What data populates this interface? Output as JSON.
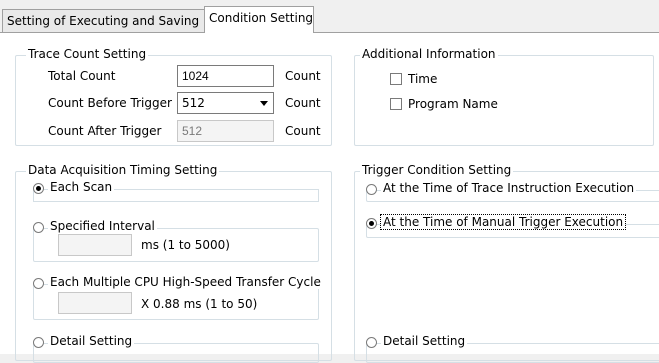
{
  "tabs": [
    {
      "label": "Setting of Executing and Saving",
      "active": false
    },
    {
      "label": "Condition Setting",
      "active": true
    }
  ],
  "trace_count": {
    "title": "Trace Count Setting",
    "total_label": "Total Count",
    "total_value": "1024",
    "before_label": "Count Before Trigger",
    "before_value": "512",
    "after_label": "Count After Trigger",
    "after_value": "512",
    "unit": "Count"
  },
  "additional_info": {
    "title": "Additional Information",
    "time_label": "Time",
    "time_checked": false,
    "program_label": "Program Name",
    "program_checked": false
  },
  "data_acquisition": {
    "title": "Data Acquisition Timing Setting",
    "each_scan_label": "Each Scan",
    "each_scan_selected": true,
    "specified_interval_label": "Specified Interval",
    "specified_interval_value": "",
    "specified_interval_unit": "ms (1 to 5000)",
    "multi_cpu_label": "Each Multiple CPU High-Speed Transfer Cycle",
    "multi_cpu_value": "",
    "multi_cpu_unit": "X 0.88 ms (1 to 50)",
    "detail_label": "Detail Setting"
  },
  "trigger_condition": {
    "title": "Trigger Condition Setting",
    "trace_instruction_label": "At the Time of Trace Instruction Execution",
    "manual_trigger_label": "At the Time of Manual Trigger Execution",
    "manual_trigger_selected": true,
    "detail_label": "Detail Setting"
  }
}
